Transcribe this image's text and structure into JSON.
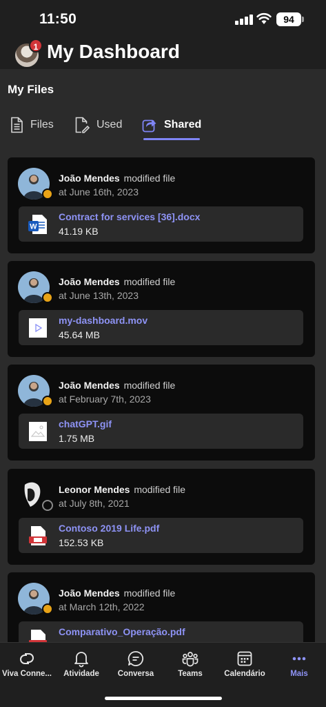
{
  "status": {
    "time": "11:50",
    "battery": "94"
  },
  "header": {
    "title": "My Dashboard",
    "notification_count": "1"
  },
  "section": {
    "title": "My Files"
  },
  "tabs": [
    {
      "label": "Files",
      "icon": "document-icon"
    },
    {
      "label": "Used",
      "icon": "edit-document-icon"
    },
    {
      "label": "Shared",
      "icon": "share-icon",
      "active": true
    }
  ],
  "activity": [
    {
      "actor": "João Mendes",
      "action": "modified file",
      "when": "at June 16th, 2023",
      "file_name": "Contract for services [36].docx",
      "file_size": "41.19 KB",
      "file_type": "word"
    },
    {
      "actor": "João Mendes",
      "action": "modified file",
      "when": "at June 13th, 2023",
      "file_name": "my-dashboard.mov",
      "file_size": "45.64 MB",
      "file_type": "video"
    },
    {
      "actor": "João Mendes",
      "action": "modified file",
      "when": "at February 7th, 2023",
      "file_name": "chatGPT.gif",
      "file_size": "1.75 MB",
      "file_type": "image"
    },
    {
      "actor": "Leonor Mendes",
      "action": "modified file",
      "when": "at July 8th, 2021",
      "file_name": "Contoso 2019 Life.pdf",
      "file_size": "152.53 KB",
      "file_type": "pdf"
    },
    {
      "actor": "João Mendes",
      "action": "modified file",
      "when": "at March 12th, 2022",
      "file_name": "Comparativo_Operação.pdf",
      "file_size": "",
      "file_type": "pdf"
    }
  ],
  "nav": [
    {
      "label": "Viva Conne...",
      "icon": "viva-connections-icon"
    },
    {
      "label": "Atividade",
      "icon": "bell-icon"
    },
    {
      "label": "Conversa",
      "icon": "chat-icon"
    },
    {
      "label": "Teams",
      "icon": "teams-icon"
    },
    {
      "label": "Calendário",
      "icon": "calendar-icon"
    },
    {
      "label": "Mais",
      "icon": "more-icon",
      "active": true
    }
  ],
  "colors": {
    "accent": "#7f85f5",
    "link": "#8e93f5",
    "away": "#e8a317",
    "badge": "#d13438"
  }
}
